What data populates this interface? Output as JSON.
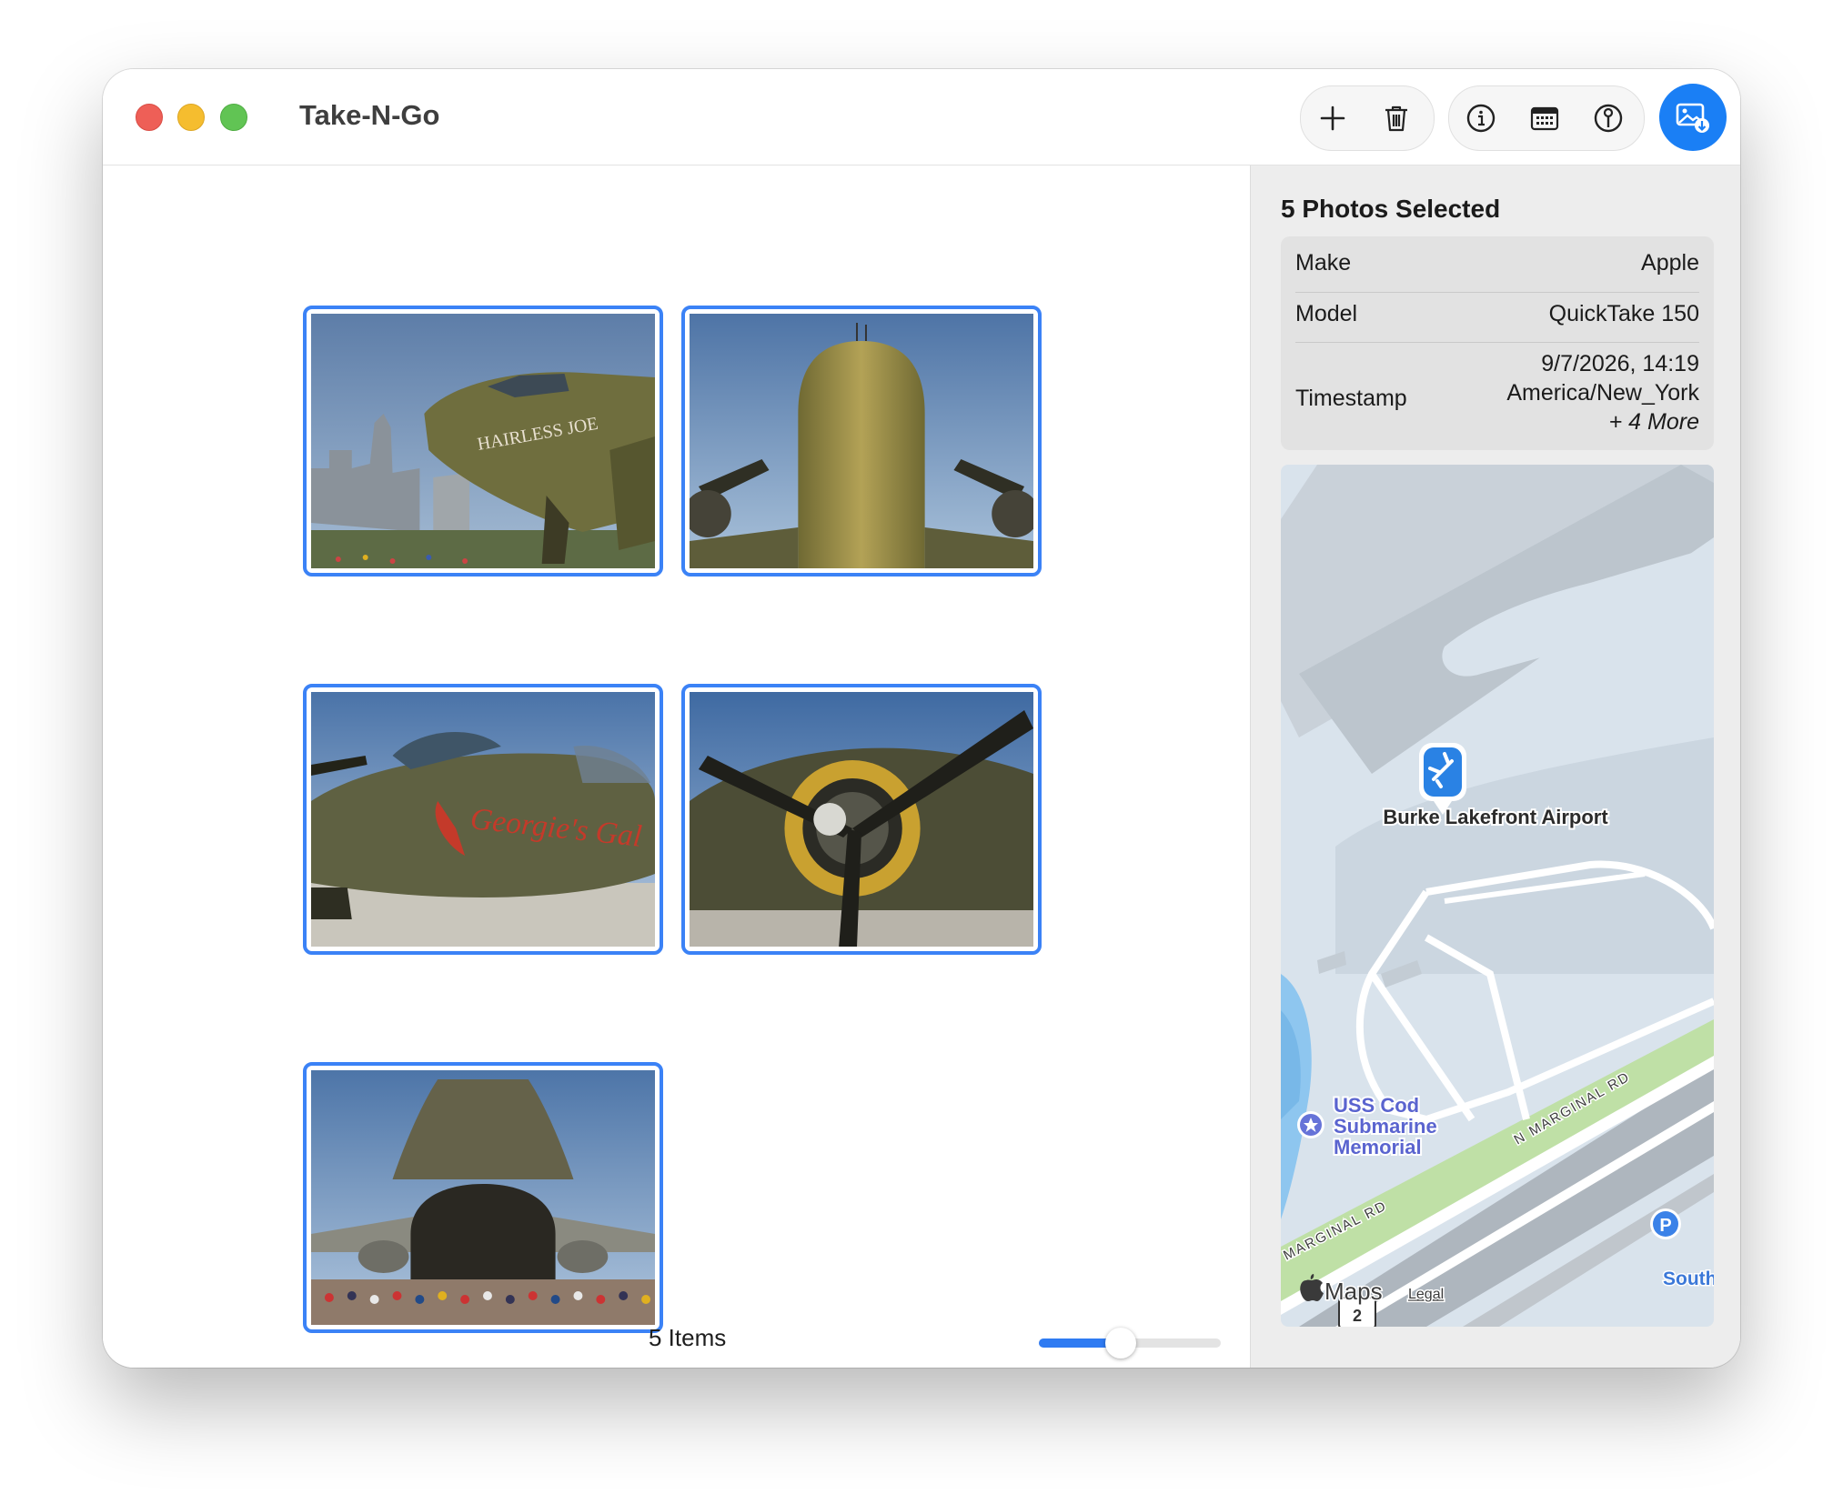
{
  "window": {
    "title": "Take-N-Go"
  },
  "toolbar": {
    "buttons": [
      {
        "name": "add",
        "icon": "plus-icon"
      },
      {
        "name": "delete",
        "icon": "trash-icon"
      },
      {
        "name": "info",
        "icon": "info-circle-icon"
      },
      {
        "name": "calendar",
        "icon": "calendar-icon"
      },
      {
        "name": "location",
        "icon": "location-pin-icon"
      },
      {
        "name": "import",
        "icon": "photo-import-icon"
      }
    ],
    "accent": "#1a7ff5"
  },
  "gallery": {
    "photos": [
      {
        "subject": "C-47 nose, Hairless Joe",
        "nose_art": "HAIRLESS JOE"
      },
      {
        "subject": "C-47 front view"
      },
      {
        "subject": "B-25 nose, Georgie's Gal",
        "nose_art": "Georgie's Gal"
      },
      {
        "subject": "B-25 engine and propeller"
      },
      {
        "subject": "C-5 Galaxy open nose with crowd"
      }
    ],
    "selection_color": "#3b82f6",
    "status": "5 Items",
    "zoom_slider": 0.45
  },
  "inspector": {
    "title": "5 Photos Selected",
    "rows": [
      {
        "label": "Make",
        "value": "Apple"
      },
      {
        "label": "Model",
        "value": "QuickTake 150"
      },
      {
        "label": "Timestamp",
        "value_line1": "9/7/2026, 14:19",
        "value_line2": "America/New_York",
        "more": "+ 4 More"
      }
    ],
    "map": {
      "pin_label": "Burke Lakefront Airport",
      "poi_label_lines": [
        "USS Cod",
        "Submarine",
        "Memorial"
      ],
      "road_label_1": "N MARGINAL RD",
      "road_label_2": "MARGINAL RD",
      "edge_label": "South",
      "parking": "P",
      "route_shield": "2",
      "brand": "Maps",
      "legal": "Legal"
    }
  }
}
